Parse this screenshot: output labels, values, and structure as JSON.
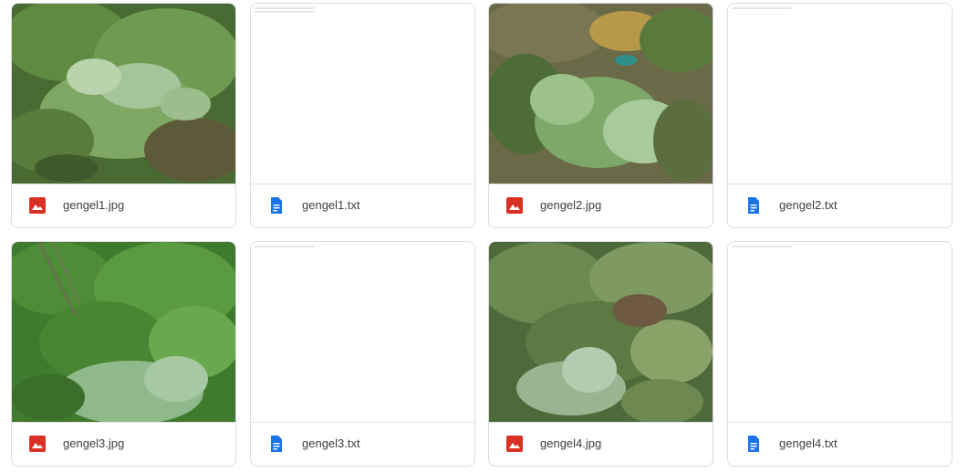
{
  "files": [
    {
      "name": "gengel1.jpg",
      "type": "image",
      "icon": "image-file-icon",
      "color": "#d93025"
    },
    {
      "name": "gengel1.txt",
      "type": "text",
      "icon": "doc-file-icon",
      "color": "#1a73e8"
    },
    {
      "name": "gengel2.jpg",
      "type": "image",
      "icon": "image-file-icon",
      "color": "#d93025"
    },
    {
      "name": "gengel2.txt",
      "type": "text",
      "icon": "doc-file-icon",
      "color": "#1a73e8"
    },
    {
      "name": "gengel3.jpg",
      "type": "image",
      "icon": "image-file-icon",
      "color": "#d93025"
    },
    {
      "name": "gengel3.txt",
      "type": "text",
      "icon": "doc-file-icon",
      "color": "#1a73e8"
    },
    {
      "name": "gengel4.jpg",
      "type": "image",
      "icon": "image-file-icon",
      "color": "#d93025"
    },
    {
      "name": "gengel4.txt",
      "type": "text",
      "icon": "doc-file-icon",
      "color": "#1a73e8"
    }
  ]
}
